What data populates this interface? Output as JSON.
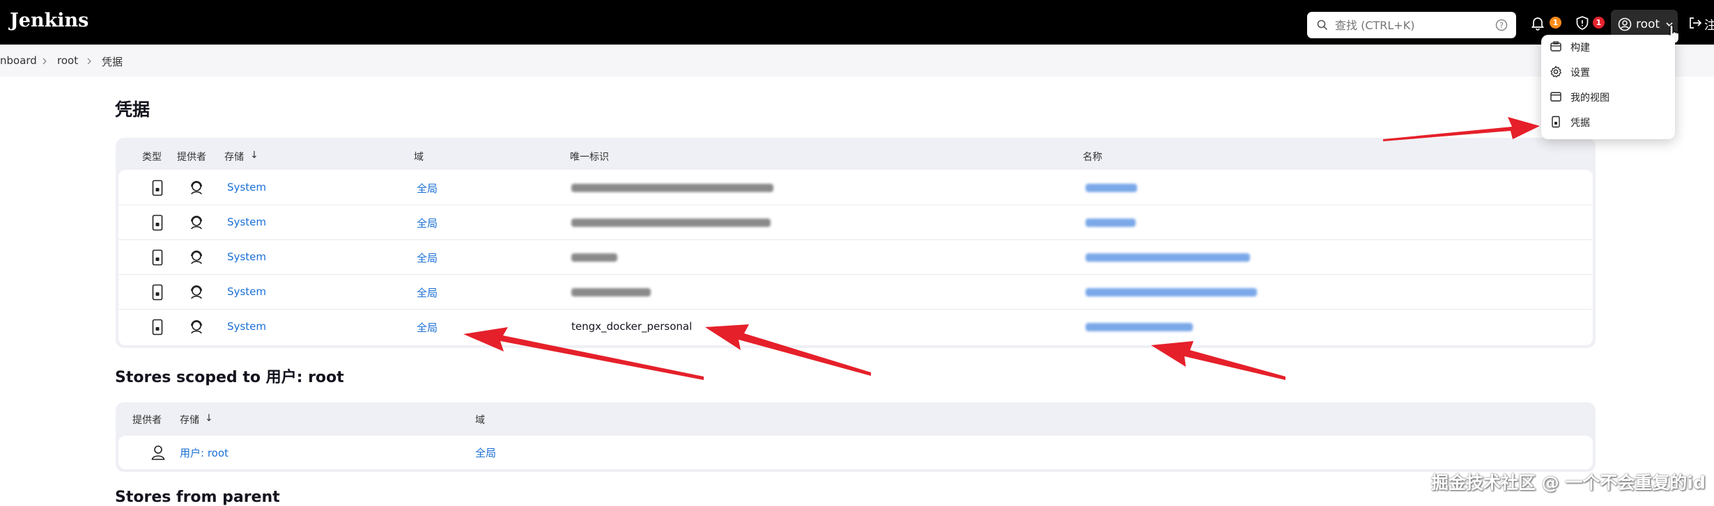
{
  "app": {
    "brand": "Jenkins",
    "search_placeholder": "查找 (CTRL+K)",
    "notifications_count": "1",
    "security_count": "1",
    "user_name": "root",
    "logout_label": "注"
  },
  "breadcrumb": [
    "nboard",
    "root",
    "凭据"
  ],
  "page_title": "凭据",
  "credentials_table": {
    "headers": [
      "类型",
      "提供者",
      "存储",
      "↓",
      "域",
      "唯一标识",
      "名称"
    ],
    "rows": [
      {
        "store": "System",
        "domain": "全局",
        "id": "",
        "name": ""
      },
      {
        "store": "System",
        "domain": "全局",
        "id": "",
        "name": ""
      },
      {
        "store": "System",
        "domain": "全局",
        "id": "",
        "name": ""
      },
      {
        "store": "System",
        "domain": "全局",
        "id": "",
        "name": ""
      },
      {
        "store": "System",
        "domain": "全局",
        "id": "tengx_docker_personal",
        "name": ""
      }
    ]
  },
  "stores_scoped": {
    "title": "Stores scoped to 用户: root",
    "headers": [
      "提供者",
      "存储",
      "↓",
      "域"
    ],
    "rows": [
      {
        "store": "用户: root",
        "domain": "全局"
      }
    ]
  },
  "stores_parent": {
    "title": "Stores from parent"
  },
  "user_menu": {
    "items": [
      {
        "label": "构建",
        "icon": "build-icon"
      },
      {
        "label": "设置",
        "icon": "gear-icon"
      },
      {
        "label": "我的视图",
        "icon": "window-icon"
      },
      {
        "label": "凭据",
        "icon": "credentials-icon"
      }
    ]
  },
  "watermark": "掘金技术社区 @ 一个不会重复的id",
  "colors": {
    "topbar": "#000000",
    "link": "#1a6fd6",
    "panel": "#eff0f5",
    "badge_orange": "#ff8c1a",
    "badge_red": "#e5242f",
    "annotation_arrow": "#e5202a"
  }
}
